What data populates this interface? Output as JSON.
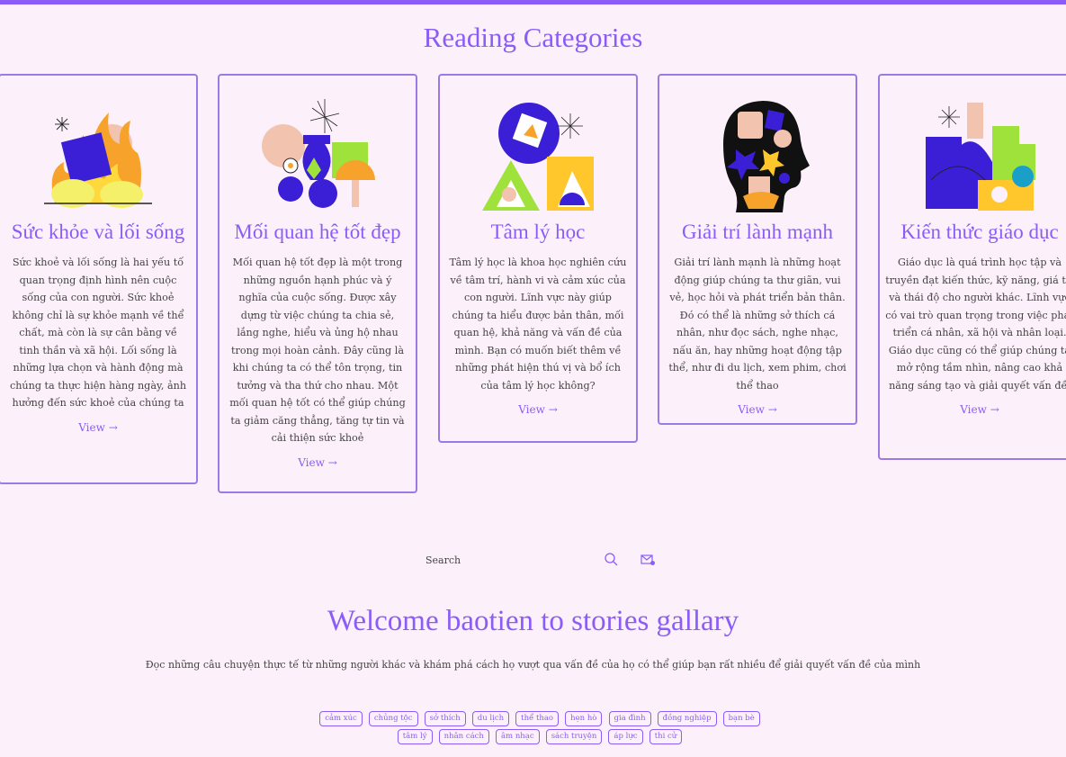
{
  "header": {
    "title": "Reading Categories"
  },
  "categories": [
    {
      "title": "Sức khỏe và lối sống",
      "description": "Sức khoẻ và lối sống là hai yếu tố quan trọng định hình nên cuộc sống của con người. Sức khoẻ không chỉ là sự khỏe mạnh về thể chất, mà còn là sự cân bằng về tinh thần và xã hội. Lối sống là những lựa chọn và hành động mà chúng ta thực hiện hàng ngày, ảnh hưởng đến sức khoẻ của chúng ta",
      "view": "View →",
      "art": "fire-shapes-illustration"
    },
    {
      "title": "Mối quan hệ tốt đẹp",
      "description": "Mối quan hệ tốt đẹp là một trong những nguồn hạnh phúc và ý nghĩa của cuộc sống. Được xây dựng từ việc chúng ta chia sẻ, lắng nghe, hiểu và ủng hộ nhau trong mọi hoàn cảnh. Đây cũng là khi chúng ta có thể tôn trọng, tin tưởng và tha thứ cho nhau. Một mối quan hệ tốt có thể giúp chúng ta giảm căng thẳng, tăng tự tin và cải thiện sức khoẻ",
      "view": "View →",
      "art": "vases-illustration"
    },
    {
      "title": "Tâm lý học",
      "description": "Tâm lý học là khoa học nghiên cứu về tâm trí, hành vi và cảm xúc của con người. Lĩnh vực này giúp chúng ta hiểu được bản thân, mối quan hệ, khả năng và vấn đề của mình. Bạn có muốn biết thêm về những phát hiện thú vị và bổ ích của tâm lý học không?",
      "view": "View →",
      "art": "geometric-triangles-illustration"
    },
    {
      "title": "Giải trí lành mạnh",
      "description": "Giải trí lành mạnh là những hoạt động giúp chúng ta thư giãn, vui vẻ, học hỏi và phát triển bản thân. Đó có thể là những sở thích cá nhân, như đọc sách, nghe nhạc, nấu ăn, hay những hoạt động tập thể, như đi du lịch, xem phim, chơi thể thao",
      "view": "View →",
      "art": "head-silhouette-illustration"
    },
    {
      "title": "Kiến thức giáo dục",
      "description": "Giáo dục là quá trình học tập và truyền đạt kiến thức, kỹ năng, giá trị và thái độ cho người khác. Lĩnh vực có vai trò quan trọng trong việc phát triển cá nhân, xã hội và nhân loại. Giáo dục cũng có thể giúp chúng ta mở rộng tầm nhìn, nâng cao khả năng sáng tạo và giải quyết vấn đề.",
      "view": "View →",
      "art": "blocks-illustration"
    }
  ],
  "search": {
    "placeholder": "Search",
    "search_icon": "search-icon",
    "mail_icon": "mail-icon"
  },
  "welcome": {
    "title": "Welcome baotien to stories gallary",
    "description": "Đọc những câu chuyện thực tế từ những người khác và khám phá cách họ vượt qua vấn đề của họ có thể giúp bạn rất nhiều để giải quyết vấn đề của mình"
  },
  "tags_row1": [
    "cảm xúc",
    "chủng tộc",
    "sở thích",
    "du lịch",
    "thể thao",
    "hẹn hò",
    "gia đình",
    "đồng nghiệp",
    "bạn bè"
  ],
  "tags_row2": [
    "tâm lý",
    "nhân cách",
    "âm nhạc",
    "sách truyện",
    "áp lực",
    "thi cử"
  ],
  "colors": {
    "accent": "#8b5cf6",
    "background": "#fcf1fb"
  }
}
